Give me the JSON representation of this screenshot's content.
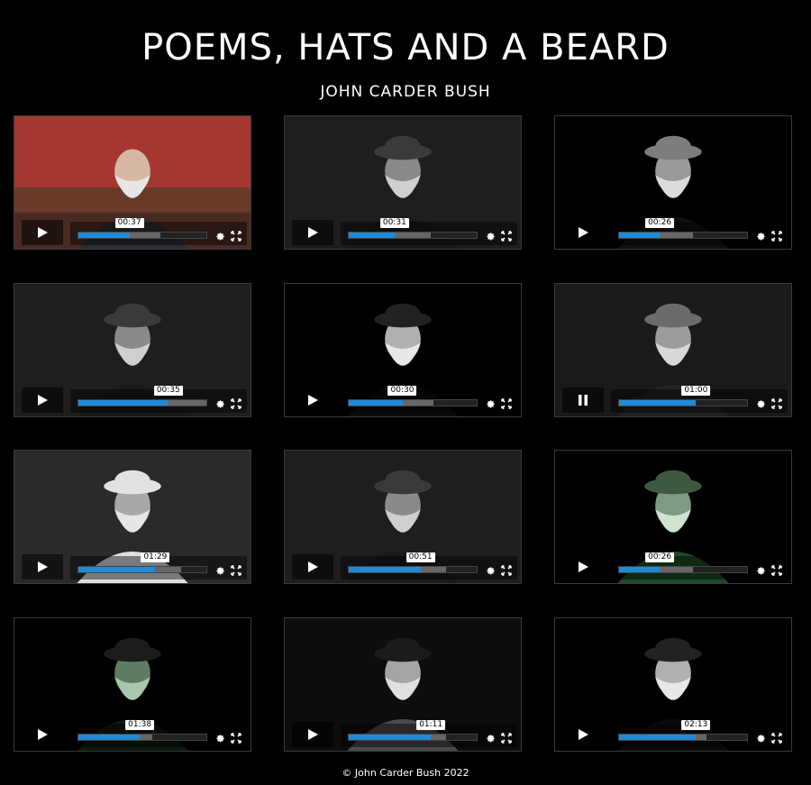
{
  "page": {
    "title": "POEMS, HATS AND A BEARD",
    "subtitle": "JOHN CARDER BUSH",
    "footer": "© John Carder Bush 2022"
  },
  "colors": {
    "progress": "#1f8bd6",
    "background": "#000000"
  },
  "videos": [
    {
      "time": "00:37",
      "played": 0.4,
      "buffered": 0.64,
      "state": "paused",
      "bg": "red-wall"
    },
    {
      "time": "00:31",
      "played": 0.36,
      "buffered": 0.64,
      "state": "paused",
      "bg": "dark-gray"
    },
    {
      "time": "00:26",
      "played": 0.32,
      "buffered": 0.58,
      "state": "paused",
      "bg": "helmet"
    },
    {
      "time": "00:35",
      "played": 0.7,
      "buffered": 1.0,
      "state": "paused",
      "bg": "dark-gray"
    },
    {
      "time": "00:30",
      "played": 0.42,
      "buffered": 0.66,
      "state": "paused",
      "bg": "black"
    },
    {
      "time": "01:00",
      "played": 0.6,
      "buffered": 0.6,
      "state": "playing",
      "bg": "fur"
    },
    {
      "time": "01:29",
      "played": 0.6,
      "buffered": 0.8,
      "state": "paused",
      "bg": "white-hat"
    },
    {
      "time": "00:51",
      "played": 0.56,
      "buffered": 0.76,
      "state": "paused",
      "bg": "dark-gray"
    },
    {
      "time": "00:26",
      "played": 0.32,
      "buffered": 0.58,
      "state": "paused",
      "bg": "green"
    },
    {
      "time": "01:38",
      "played": 0.48,
      "buffered": 0.58,
      "state": "paused",
      "bg": "green-dark"
    },
    {
      "time": "01:11",
      "played": 0.64,
      "buffered": 0.76,
      "state": "paused",
      "bg": "gray"
    },
    {
      "time": "02:13",
      "played": 0.6,
      "buffered": 0.68,
      "state": "paused",
      "bg": "black"
    }
  ]
}
